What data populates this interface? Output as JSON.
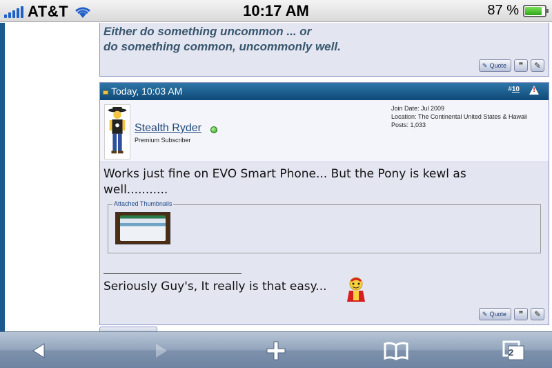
{
  "status_bar": {
    "carrier": "AT&T",
    "time": "10:17 AM",
    "battery_percent": "87 %",
    "battery_level": 0.87
  },
  "previous_post": {
    "signature_lines": [
      "Either do something uncommon ... or",
      "do something common, uncommonly well."
    ],
    "quote_label": "Quote"
  },
  "post": {
    "date": "Today, 10:03 AM",
    "number_prefix": "#",
    "number": "10",
    "username": "Stealth Ryder",
    "user_title": "Premium Subscriber",
    "join_date": "Join Date: Jul 2009",
    "location": "Location: The Continental United States & Hawaii",
    "posts": "Posts: 1,033",
    "message": "Works just fine on EVO Smart Phone... But the Pony is kewl as well...........",
    "attachments_legend": "Attached Thumbnails",
    "signature_rule": "______________________",
    "signature": "Seriously Guy's, It really is that easy...",
    "quote_label": "Quote"
  },
  "toolbar": {
    "pages_count": "2"
  },
  "colors": {
    "header_blue": "#1c5a8e",
    "post_bg": "#e3e5f1",
    "signature_text": "#38566d",
    "username_link": "#22497a",
    "online": "#2d9b1b"
  }
}
